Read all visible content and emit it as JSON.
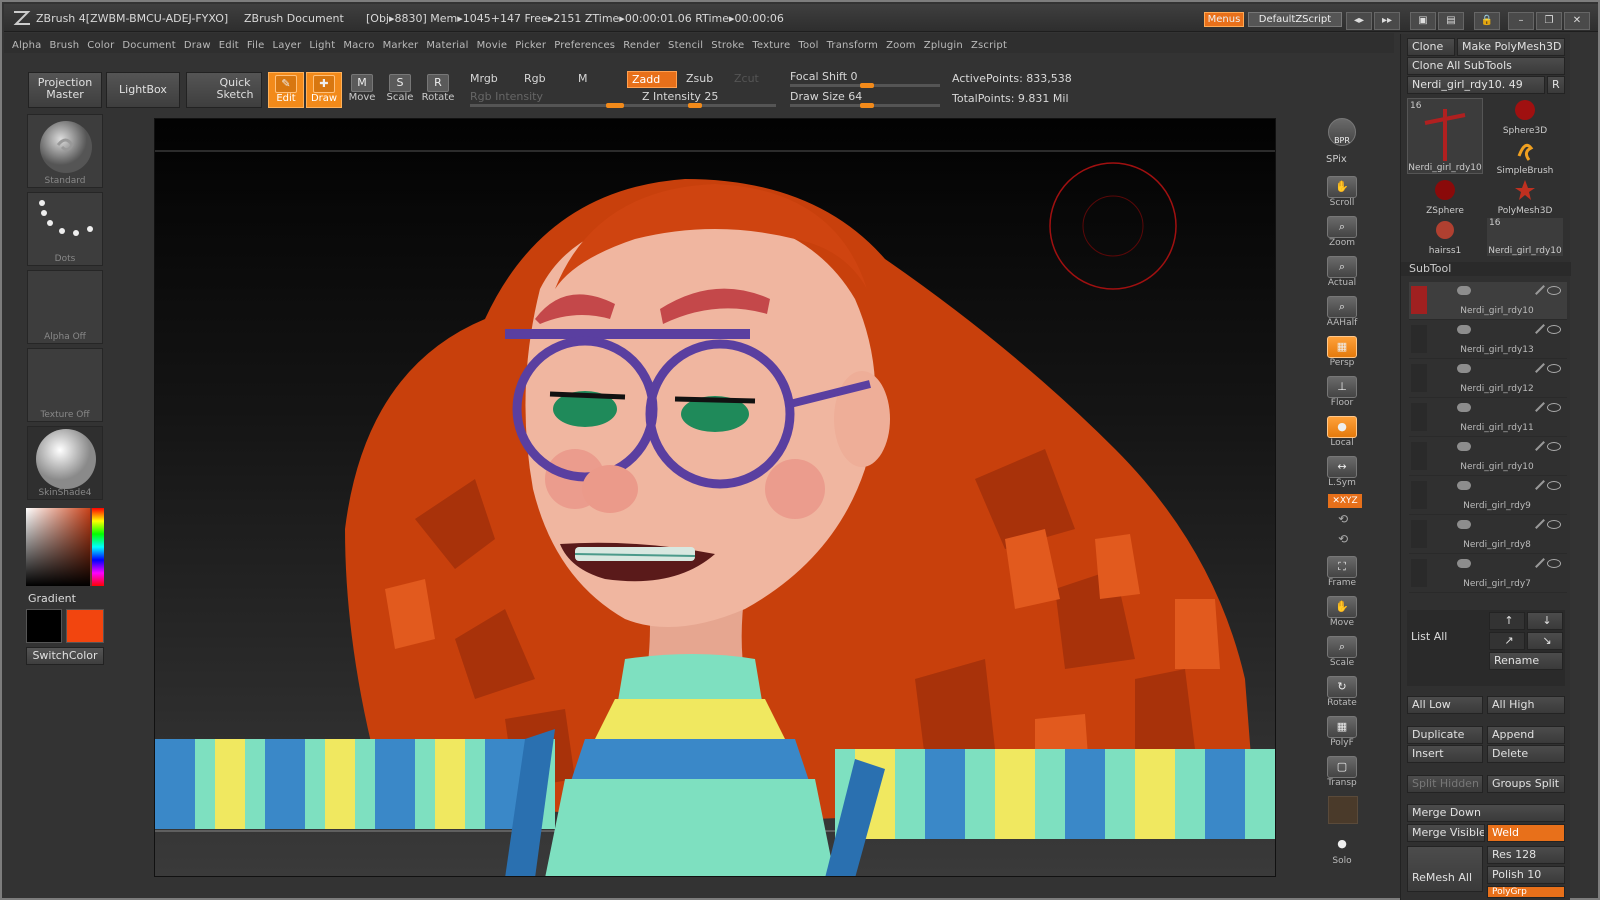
{
  "titlebar": {
    "app": "ZBrush 4[ZWBM-BMCU-ADEJ-FYXO]",
    "doc": "ZBrush Document",
    "stats": "[Obj▸8830] Mem▸1045+147 Free▸2151 ZTime▸00:00:01.06 RTime▸00:00:06",
    "menus_btn": "Menus",
    "script_btn": "DefaultZScript"
  },
  "menubar": [
    "Alpha",
    "Brush",
    "Color",
    "Document",
    "Draw",
    "Edit",
    "File",
    "Layer",
    "Light",
    "Macro",
    "Marker",
    "Material",
    "Movie",
    "Picker",
    "Preferences",
    "Render",
    "Stencil",
    "Stroke",
    "Texture",
    "Tool",
    "Transform",
    "Zoom",
    "Zplugin",
    "Zscript"
  ],
  "shelf": {
    "projection_master": "Projection Master",
    "lightbox": "LightBox",
    "quick_sketch": "Quick Sketch",
    "edit": "Edit",
    "draw": "Draw",
    "move": "Move",
    "scale": "Scale",
    "rotate": "Rotate",
    "mrgb": "Mrgb",
    "rgb": "Rgb",
    "m": "M",
    "rgb_intensity": "Rgb Intensity",
    "zadd": "Zadd",
    "zsub": "Zsub",
    "zcut": "Zcut",
    "z_intensity": "Z Intensity 25",
    "focal_shift": "Focal Shift 0",
    "draw_size": "Draw Size 64",
    "active_points": "ActivePoints: 833,538",
    "total_points": "TotalPoints: 9.831 Mil"
  },
  "leftcol": {
    "brush": "Standard",
    "stroke": "Dots",
    "alpha": "Alpha Off",
    "texture": "Texture Off",
    "material": "SkinShade4",
    "gradient": "Gradient",
    "switch_color": "SwitchColor"
  },
  "rtools": {
    "bpr": "BPR",
    "spix": "SPix",
    "scroll": "Scroll",
    "zoom": "Zoom",
    "actual": "Actual",
    "aahalf": "AAHalf",
    "persp": "Persp",
    "floor": "Floor",
    "local": "Local",
    "lsym": "L.Sym",
    "xyz": "✕XYZ",
    "frame": "Frame",
    "move": "Move",
    "scale": "Scale",
    "rotate": "Rotate",
    "polyf": "PolyF",
    "transp": "Transp",
    "solo": "Solo"
  },
  "rpanel": {
    "clone": "Clone",
    "make_polymesh": "Make PolyMesh3D",
    "clone_all": "Clone All SubTools",
    "current_tool": "Nerdi_girl_rdy10. 49",
    "r": "R",
    "tools": [
      {
        "label": "Nerdi_girl_rdy10",
        "count": "16"
      },
      {
        "label": "Sphere3D"
      },
      {
        "label": "SimpleBrush"
      },
      {
        "label": "ZSphere"
      },
      {
        "label": "PolyMesh3D"
      },
      {
        "label": "hairss1"
      },
      {
        "label": "Nerdi_girl_rdy10",
        "count": "16"
      }
    ],
    "subtool_header": "SubTool",
    "subtools": [
      "Nerdi_girl_rdy10",
      "Nerdi_girl_rdy13",
      "Nerdi_girl_rdy12",
      "Nerdi_girl_rdy11",
      "Nerdi_girl_rdy10",
      "Nerdi_girl_rdy9",
      "Nerdi_girl_rdy8",
      "Nerdi_girl_rdy7"
    ],
    "list_all": "List All",
    "rename": "Rename",
    "all_low": "All Low",
    "all_high": "All High",
    "duplicate": "Duplicate",
    "append": "Append",
    "insert": "Insert",
    "delete": "Delete",
    "split_hidden": "Split Hidden",
    "groups_split": "Groups Split",
    "merge_down": "Merge Down",
    "merge_visible": "Merge Visible",
    "weld": "Weld",
    "remesh_all": "ReMesh All",
    "res": "Res 128",
    "polish": "Polish 10",
    "polygrp": "PolyGrp"
  }
}
